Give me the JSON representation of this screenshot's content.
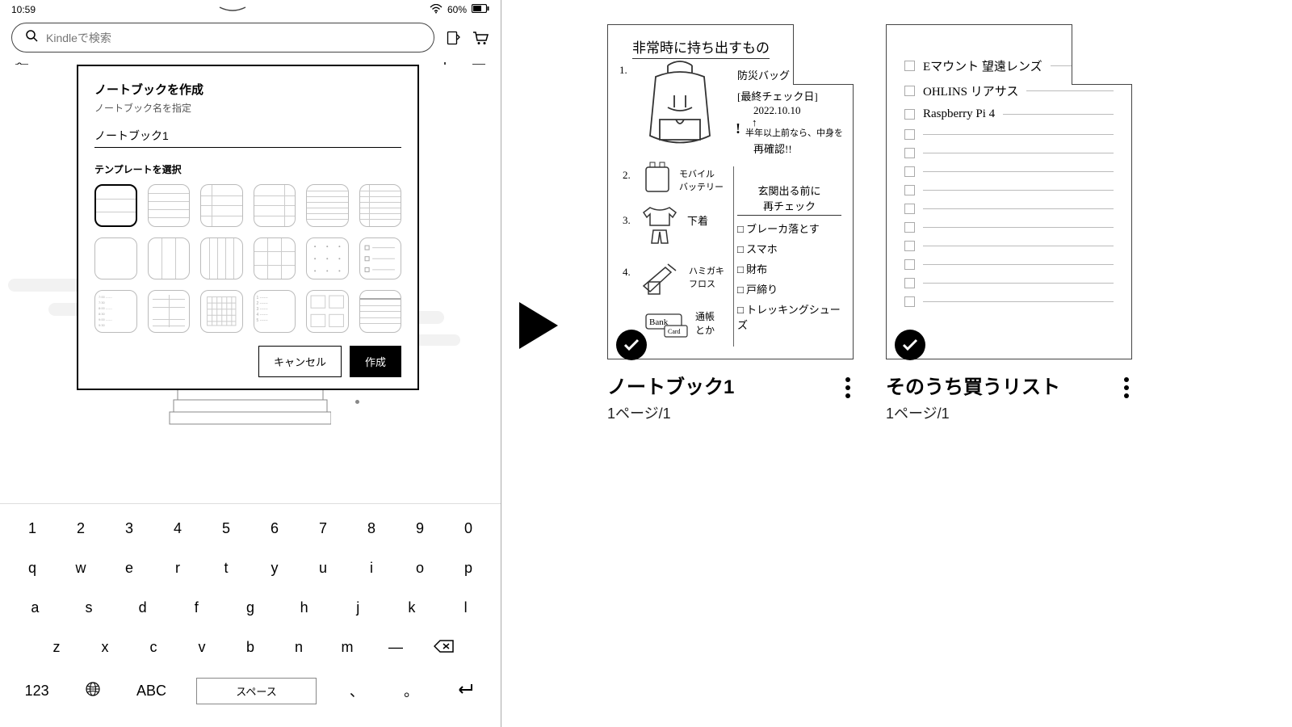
{
  "status": {
    "time": "10:59",
    "battery_pct": "60%"
  },
  "search": {
    "placeholder": "Kindleで検索"
  },
  "dialog": {
    "title": "ノートブックを作成",
    "subtitle": "ノートブック名を指定",
    "name_value": "ノートブック1",
    "template_label": "テンプレートを選択",
    "cancel": "キャンセル",
    "create": "作成"
  },
  "keyboard": {
    "row1": [
      "1",
      "2",
      "3",
      "4",
      "5",
      "6",
      "7",
      "8",
      "9",
      "0"
    ],
    "row2": [
      "q",
      "w",
      "e",
      "r",
      "t",
      "y",
      "u",
      "i",
      "o",
      "p"
    ],
    "row3": [
      "a",
      "s",
      "d",
      "f",
      "g",
      "h",
      "j",
      "k",
      "l"
    ],
    "row4": [
      "z",
      "x",
      "c",
      "v",
      "b",
      "n",
      "m",
      "—",
      "⌫"
    ],
    "mode_num": "123",
    "mode_abc": "ABC",
    "space": "スペース",
    "punct1": "、",
    "punct2": "。"
  },
  "notebooks": [
    {
      "title": "ノートブック1",
      "meta": "1ページ/1",
      "content": {
        "heading": "非常時に持ち出すもの",
        "tag1": "防災バッグ",
        "last_check_label": "[最終チェック日]",
        "last_check_date": "2022.10.10",
        "note_arrow": "↑",
        "note1": "半年以上前なら、中身を",
        "note2": "再確認!!",
        "items_left": [
          {
            "n": "1.",
            "t": ""
          },
          {
            "n": "2.",
            "t": "モバイル\nバッテリー"
          },
          {
            "n": "3.",
            "t": "下着"
          },
          {
            "n": "4.",
            "t": "ハミガキ\nフロス"
          }
        ],
        "bank": "Bank",
        "card": "Card",
        "passbook": "通帳\nとか",
        "right_head1": "玄関出る前に",
        "right_head2": "再チェック",
        "right_checks": [
          "ブレーカ落とす",
          "スマホ",
          "財布",
          "戸締り",
          "トレッキングシューズ"
        ]
      }
    },
    {
      "title": "そのうち買うリスト",
      "meta": "1ページ/1",
      "content": {
        "items": [
          "Eマウント 望遠レンズ",
          "OHLINS リアサス",
          "Raspberry Pi 4"
        ]
      }
    }
  ]
}
